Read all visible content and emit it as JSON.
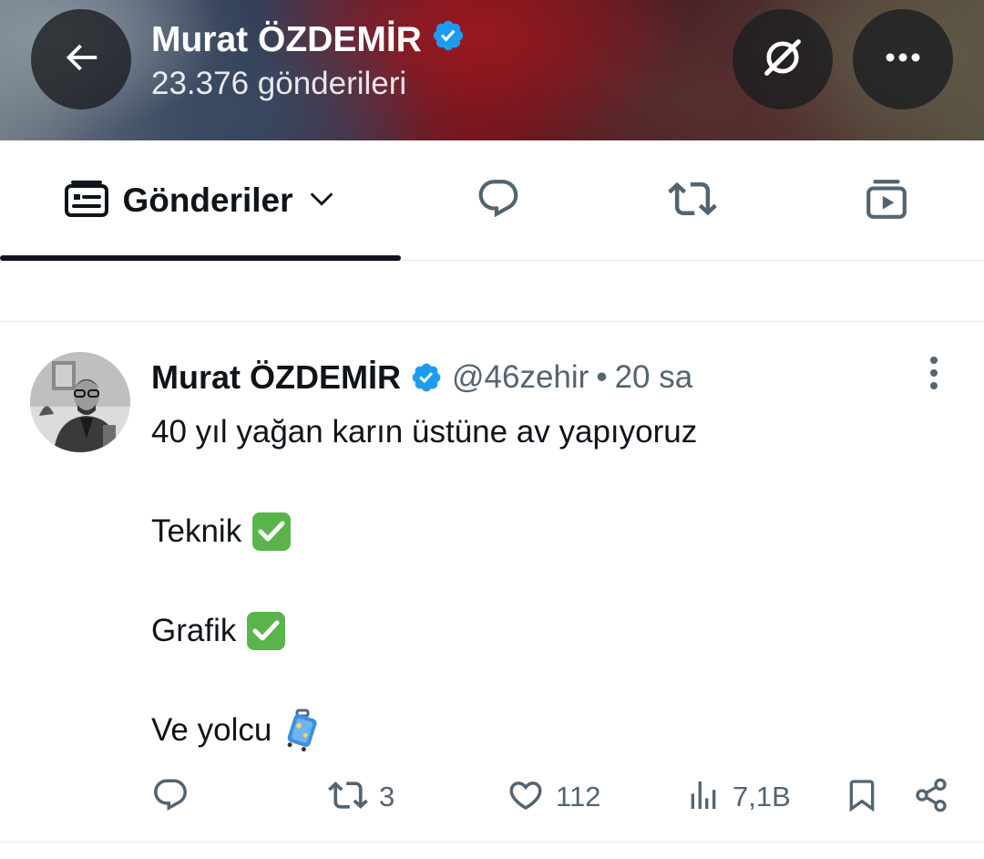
{
  "header": {
    "name": "Murat ÖZDEMİR",
    "post_count": "23.376 gönderileri"
  },
  "tabs": {
    "posts_label": "Gönderiler",
    "icons": [
      "posts-feed-icon",
      "replies-icon",
      "reposts-icon",
      "media-video-icon"
    ]
  },
  "post": {
    "author_name": "Murat ÖZDEMİR",
    "handle": "@46zehir",
    "separator": "•",
    "time": "20 sa",
    "lines": [
      "40 yıl yağan karın üstüne av yapıyoruz",
      "",
      "Teknik",
      "",
      "Grafik",
      "",
      "Ve yolcu"
    ],
    "emojis": [
      "check-mark-emoji",
      "check-mark-emoji",
      "luggage-emoji"
    ],
    "actions": {
      "reposts": "3",
      "likes": "112",
      "views": "7,1B"
    }
  },
  "colors": {
    "verified": "#1d9bf0",
    "text": "#0f1419",
    "secondary": "#536471",
    "divider": "#e6e9ec",
    "check_emoji": "#5ab34b"
  }
}
